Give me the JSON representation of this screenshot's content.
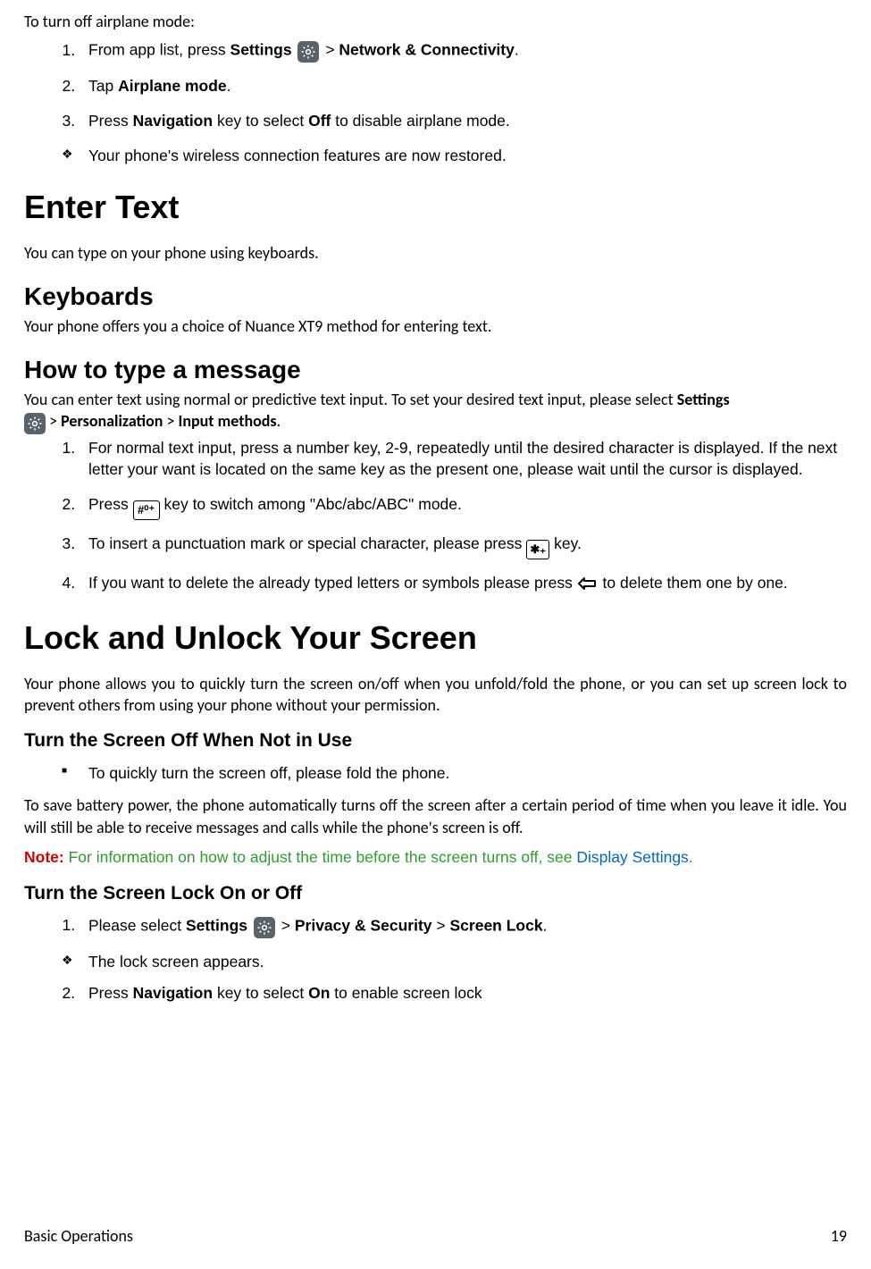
{
  "intro": "To turn off airplane mode:",
  "steps_airplane": {
    "s1a": "From app list, press ",
    "s1b": "Settings",
    "s1c": " > ",
    "s1d": "Network & Connectivity",
    "s1e": ".",
    "s2a": "Tap ",
    "s2b": "Airplane mode",
    "s2c": ".",
    "s3a": "Press ",
    "s3b": "Navigation",
    "s3c": " key to select ",
    "s3d": "Off",
    "s3e": " to disable airplane mode.",
    "sub": "Your phone's wireless connection features are now restored."
  },
  "h1_enter": "Enter Text",
  "p_enter": "You can type on your phone using keyboards.",
  "h2_kbd": "Keyboards",
  "p_kbd": "Your phone offers you a choice of Nuance XT9 method for entering text.",
  "h2_type": "How to type a message",
  "p_type_a": "You can enter text using normal or predictive text input. To set your desired text input, please select ",
  "p_type_b": "Settings",
  "p_type_c": " > ",
  "p_type_d": "Personalization",
  "p_type_e": " > ",
  "p_type_f": "Input methods",
  "p_type_g": ".",
  "type_steps": {
    "s1": "For normal text input, press a number key, 2-9, repeatedly until the desired character is displayed. If the next letter your want is located on the same key as the present one, please wait until the cursor is displayed.",
    "s2a": "Press ",
    "s2b": " key to switch among \"Abc/abc/ABC\" mode.",
    "s3a": "To insert a punctuation mark or special character, please press ",
    "s3b": " key.",
    "s4a": "If you want to delete the already typed letters or symbols please press ",
    "s4b": " to delete them one by one."
  },
  "h1_lock": "Lock and Unlock Your Screen",
  "p_lock": "Your phone allows you to quickly turn the screen on/off when you unfold/fold the phone, or you can set up screen lock to prevent others from using your phone without your permission.",
  "h3_off": "Turn the Screen Off When Not in Use",
  "li_off": "To quickly turn the screen off, please fold the phone.",
  "p_save": "To save battery power, the phone automatically turns off the screen after a certain period of time when you leave it idle. You will still be able to receive messages and calls while the phone's screen is off.",
  "note_label": "Note:",
  "note_text": " For information on how to adjust the time before the screen turns off, see ",
  "note_link": "Display Settings",
  "note_end": ".",
  "h3_lockon": "Turn the Screen Lock On or Off",
  "lock_steps": {
    "s1a": "Please select ",
    "s1b": "Settings",
    "s1c": " > ",
    "s1d": "Privacy & Security",
    "s1e": " > ",
    "s1f": "Screen Lock",
    "s1g": ".",
    "sub": "The lock screen appears.",
    "s2a": "Press ",
    "s2b": "Navigation",
    "s2c": " key to select ",
    "s2d": "On",
    "s2e": " to enable screen lock"
  },
  "footer_left": "Basic Operations",
  "footer_right": "19",
  "key_hash_glyph": "#⁰⁺",
  "key_star_glyph": "✱₊"
}
